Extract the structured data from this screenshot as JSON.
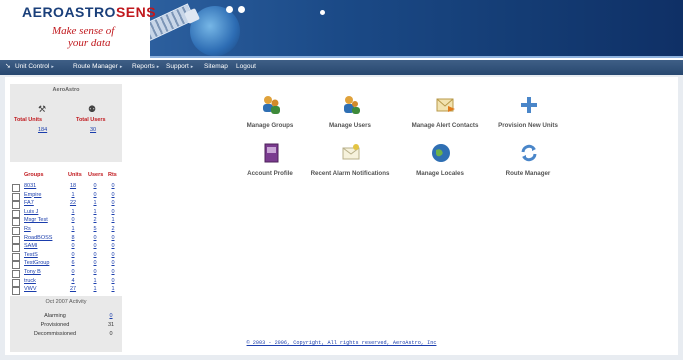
{
  "header": {
    "logo_main": "AEROASTRO",
    "logo_suffix": "SENS",
    "tagline_line1": "Make sense of",
    "tagline_line2": "your data"
  },
  "nav": {
    "items": [
      {
        "label": "Unit Control",
        "has_arrow": true
      },
      {
        "label": "Route Manager",
        "has_arrow": true
      },
      {
        "label": "Reports",
        "has_arrow": true
      },
      {
        "label": "Support",
        "has_arrow": true
      },
      {
        "label": "Sitemap",
        "has_arrow": false
      },
      {
        "label": "Logout",
        "has_arrow": false
      }
    ]
  },
  "sidebar": {
    "title": "AeroAstro",
    "total_units_label": "Total Units",
    "total_users_label": "Total Users",
    "total_units": "184",
    "total_users": "30",
    "columns": [
      "Groups",
      "Units",
      "Users",
      "Rts"
    ],
    "groups": [
      {
        "name": "8031",
        "units": "18",
        "users": "0",
        "rts": "0"
      },
      {
        "name": "Empire",
        "units": "1",
        "users": "0",
        "rts": "0"
      },
      {
        "name": "FA7",
        "units": "22",
        "users": "1",
        "rts": "0"
      },
      {
        "name": "Luis J",
        "units": "1",
        "users": "1",
        "rts": "0"
      },
      {
        "name": "Msgr Test",
        "units": "0",
        "users": "2",
        "rts": "1"
      },
      {
        "name": "Rs",
        "units": "1",
        "users": "5",
        "rts": "2"
      },
      {
        "name": "RoadBOSS",
        "units": "8",
        "users": "0",
        "rts": "0"
      },
      {
        "name": "SAMI",
        "units": "0",
        "users": "0",
        "rts": "0"
      },
      {
        "name": "TestS",
        "units": "0",
        "users": "0",
        "rts": "0"
      },
      {
        "name": "TestGroup",
        "units": "6",
        "users": "0",
        "rts": "0"
      },
      {
        "name": "Tony B",
        "units": "0",
        "users": "0",
        "rts": "0"
      },
      {
        "name": "truck",
        "units": "4",
        "users": "1",
        "rts": "0"
      },
      {
        "name": "VWV",
        "units": "27",
        "users": "1",
        "rts": "1"
      }
    ],
    "activity": {
      "title": "Oct 2007 Activity",
      "rows": [
        {
          "label": "Alarming",
          "value": "0",
          "link": true
        },
        {
          "label": "Provisioned",
          "value": "31",
          "link": false
        },
        {
          "label": "Decommissioned",
          "value": "0",
          "link": false
        }
      ]
    }
  },
  "tiles": [
    {
      "label": "Manage Groups",
      "icon": "group-icon"
    },
    {
      "label": "Manage Users",
      "icon": "users-icon"
    },
    {
      "label": "Manage Alert Contacts",
      "icon": "alert-contacts-icon"
    },
    {
      "label": "Provision New Units",
      "icon": "plus-icon"
    },
    {
      "label": "Account Profile",
      "icon": "profile-book-icon"
    },
    {
      "label": "Recent Alarm Notifications",
      "icon": "alarm-envelope-icon"
    },
    {
      "label": "Manage Locales",
      "icon": "globe-icon"
    },
    {
      "label": "Route Manager",
      "icon": "refresh-route-icon"
    }
  ],
  "footer": {
    "text": "© 2003 - 2006, Copyright, All rights reserved, AeroAstro, Inc"
  },
  "colors": {
    "brand_blue": "#1a3f7a",
    "brand_red": "#c0181d",
    "nav_bg": "#27476f",
    "link": "#1a3dac"
  }
}
